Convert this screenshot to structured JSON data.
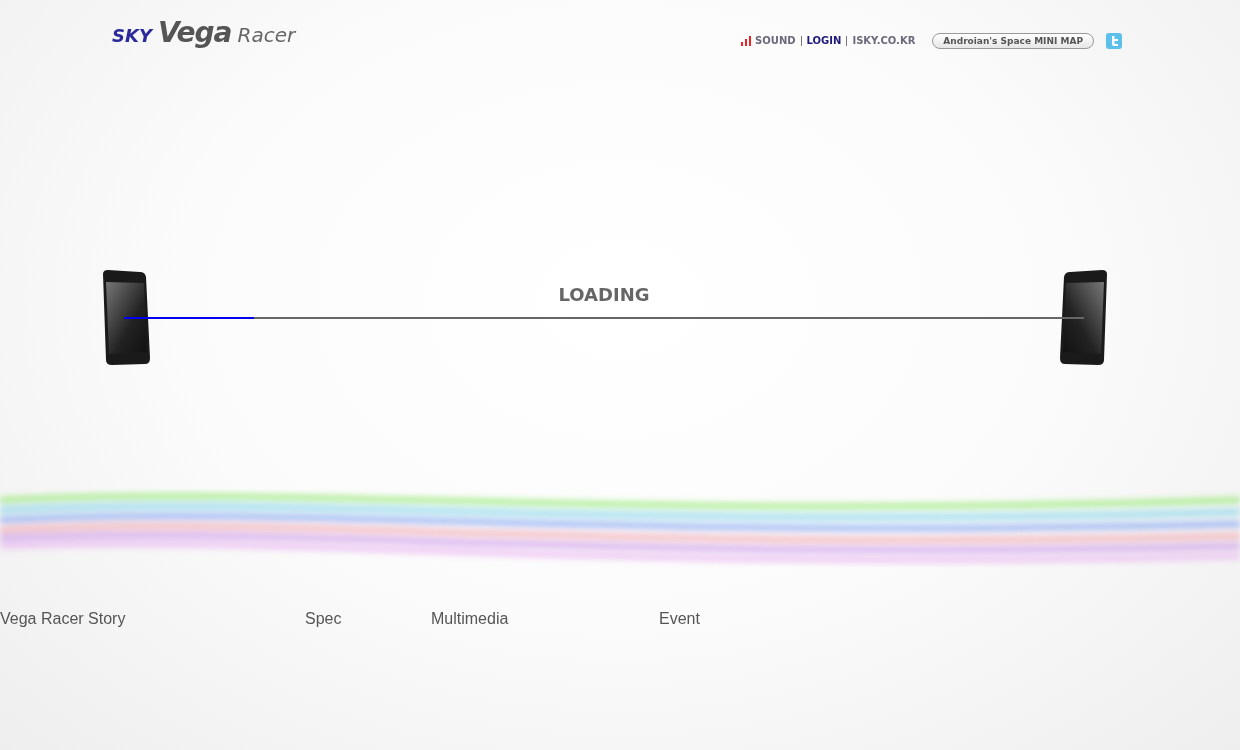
{
  "logo": {
    "brand": "SKY",
    "product": "Vega",
    "model": "Racer"
  },
  "header_links": [
    {
      "label": "SOUND",
      "kind": "sound",
      "emphasized": false
    },
    {
      "label": "LOGIN",
      "kind": "plain",
      "emphasized": true
    },
    {
      "label": "ISKY.CO.KR",
      "kind": "plain",
      "emphasized": false
    }
  ],
  "minimap_button": "Androian's Space MINI MAP",
  "loading": {
    "label": "LOADING",
    "level": 0.135
  },
  "nav": [
    "Vega Racer Story",
    "Spec",
    "Multimedia",
    "Event"
  ]
}
